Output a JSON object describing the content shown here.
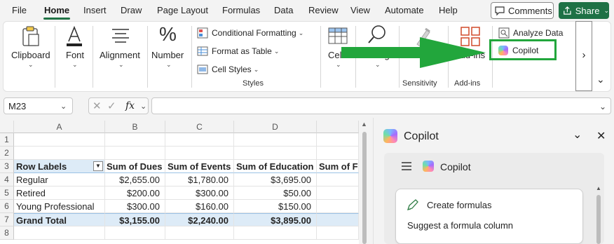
{
  "menu": {
    "items": [
      "File",
      "Home",
      "Insert",
      "Draw",
      "Page Layout",
      "Formulas",
      "Data",
      "Review",
      "View",
      "Automate",
      "Help"
    ],
    "active": "Home",
    "comments_label": "Comments",
    "share_label": "Share"
  },
  "ribbon": {
    "clipboard": "Clipboard",
    "font": "Font",
    "alignment": "Alignment",
    "number": "Number",
    "conditional_formatting": "Conditional Formatting",
    "format_as_table": "Format as Table",
    "cell_styles": "Cell Styles",
    "styles_group": "Styles",
    "cells": "Cells",
    "editing": "Editing",
    "sensitivity": "Sensitivity",
    "sensitivity_group": "Sensitivity",
    "addins": "Add-ins",
    "addins_group": "Add-ins",
    "analyze_data": "Analyze Data",
    "copilot": "Copilot",
    "more": "›",
    "highlight_color": "#22a63c"
  },
  "formula_bar": {
    "name_box": "M23",
    "fx": "fx",
    "formula": ""
  },
  "sheet": {
    "columns": [
      "A",
      "B",
      "C",
      "D"
    ],
    "rows": [
      "1",
      "2",
      "3",
      "4",
      "5",
      "6",
      "7",
      "8"
    ],
    "headers": [
      "Row Labels",
      "Sum of Dues",
      "Sum of Events",
      "Sum of Education",
      "Sum of F"
    ],
    "data": [
      [
        "Regular",
        "$2,655.00",
        "$1,780.00",
        "$3,695.00"
      ],
      [
        "Retired",
        "$200.00",
        "$300.00",
        "$50.00"
      ],
      [
        "Young Professional",
        "$300.00",
        "$160.00",
        "$150.00"
      ]
    ],
    "total": [
      "Grand Total",
      "$3,155.00",
      "$2,240.00",
      "$3,895.00"
    ]
  },
  "copilot_pane": {
    "title": "Copilot",
    "inner_title": "Copilot",
    "card_title": "Create formulas",
    "card_subtitle": "Suggest a formula column"
  }
}
